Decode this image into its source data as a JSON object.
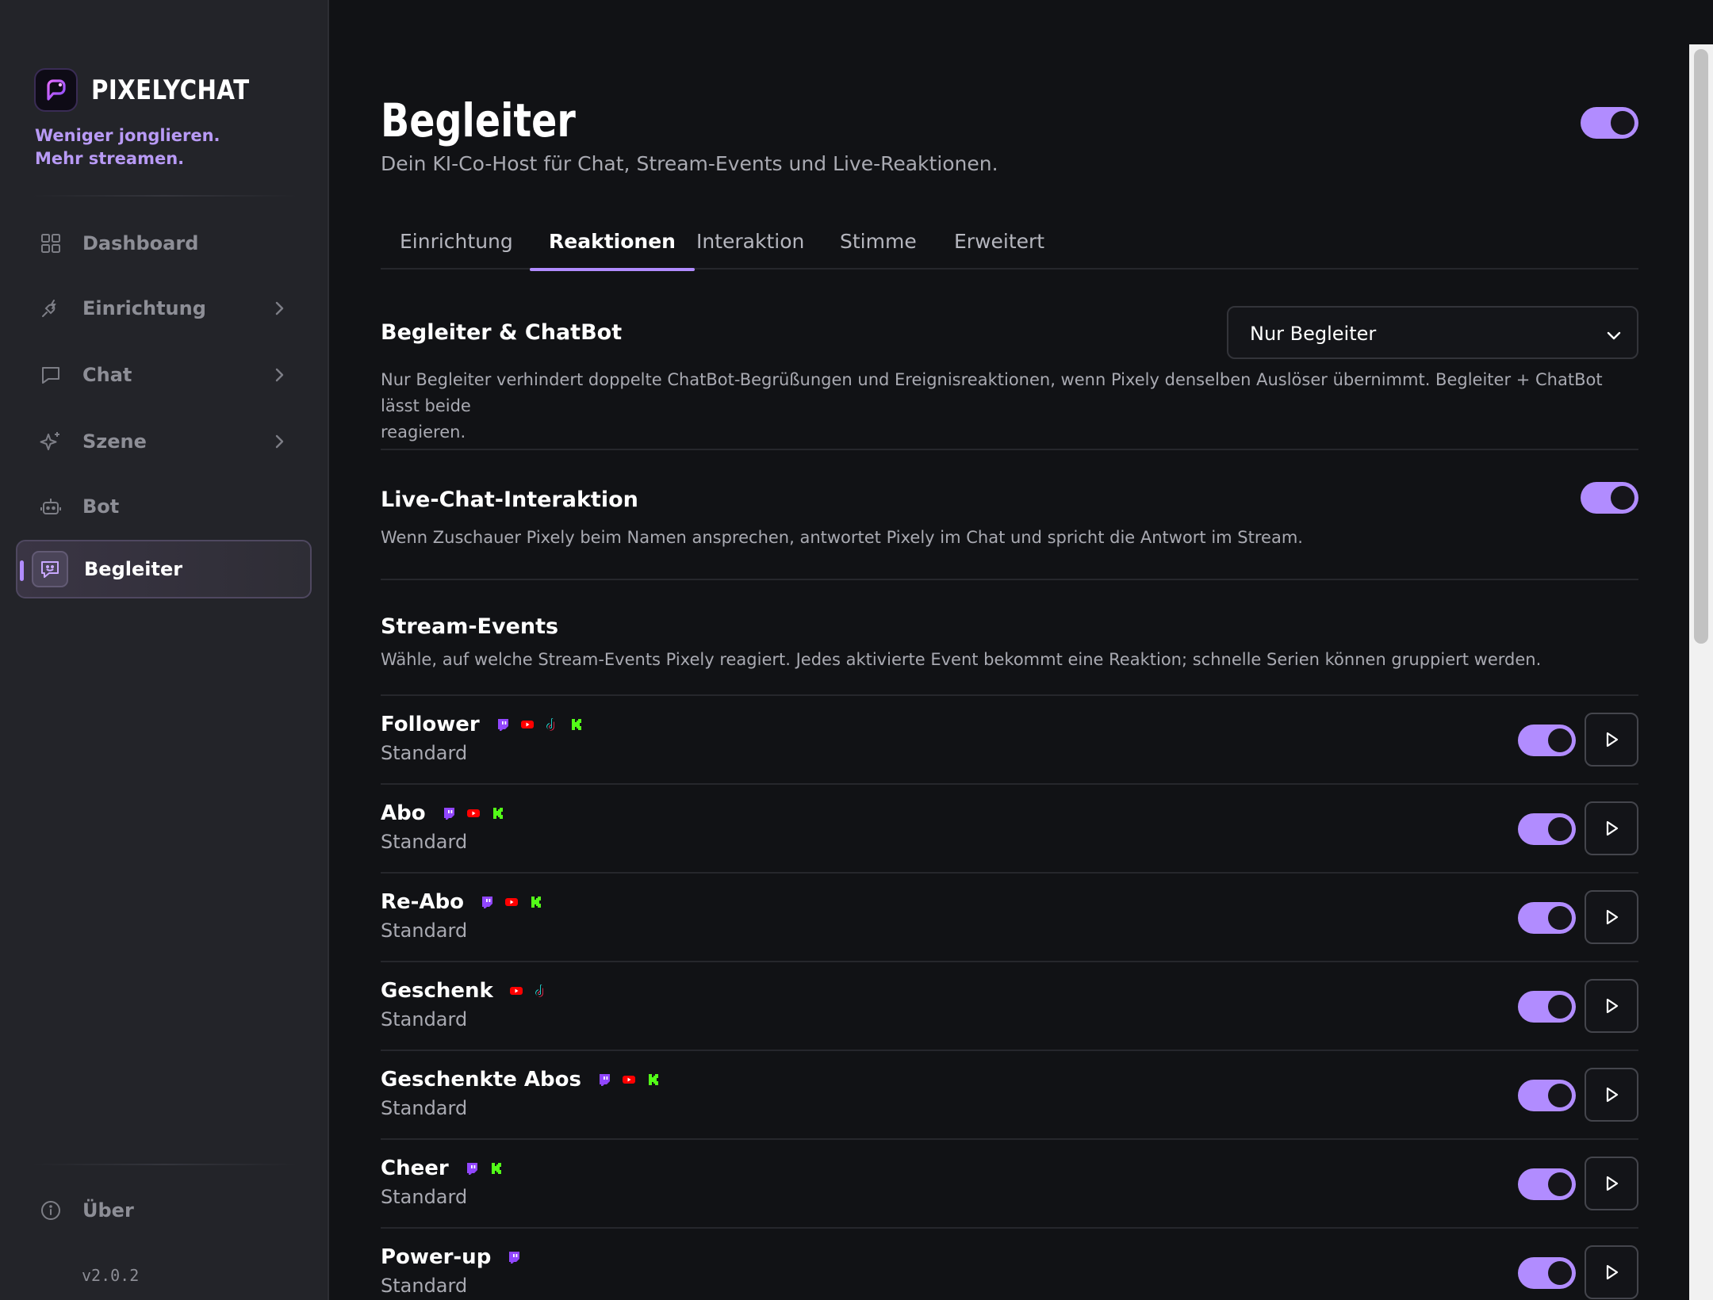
{
  "sidebar": {
    "brand": "PIXELYCHAT",
    "tagline_line1": "Weniger jonglieren.",
    "tagline_line2": "Mehr streamen.",
    "items": [
      {
        "label": "Dashboard",
        "icon": "grid-icon"
      },
      {
        "label": "Einrichtung",
        "icon": "plug-icon"
      },
      {
        "label": "Chat",
        "icon": "message-icon"
      },
      {
        "label": "Szene",
        "icon": "sparkle-icon"
      },
      {
        "label": "Bot",
        "icon": "bot-icon"
      },
      {
        "label": "Begleiter",
        "icon": "companion-icon"
      }
    ],
    "about": "Über",
    "version": "v2.0.2"
  },
  "page": {
    "title": "Begleiter",
    "subtitle": "Dein KI-Co-Host für Chat, Stream-Events und Live-Reaktionen.",
    "master_enabled": true
  },
  "tabs": [
    "Einrichtung",
    "Reaktionen",
    "Interaktion",
    "Stimme",
    "Erweitert"
  ],
  "active_tab": "Reaktionen",
  "companion_chatbot": {
    "title": "Begleiter & ChatBot",
    "selected": "Nur Begleiter",
    "desc_line1": "Nur Begleiter verhindert doppelte ChatBot-Begrüßungen und Ereignisreaktionen, wenn Pixely denselben Auslöser übernimmt. Begleiter + ChatBot lässt beide",
    "desc_line2": "reagieren."
  },
  "live_chat": {
    "title": "Live-Chat-Interaktion",
    "desc": "Wenn Zuschauer Pixely beim Namen ansprechen, antwortet Pixely im Chat und spricht die Antwort im Stream.",
    "enabled": true
  },
  "stream_events": {
    "title": "Stream-Events",
    "desc": "Wähle, auf welche Stream-Events Pixely reagiert. Jedes aktivierte Event bekommt eine Reaktion; schnelle Serien können gruppiert werden.",
    "events": [
      {
        "name": "Follower",
        "sub": "Standard",
        "platforms": [
          "twitch",
          "youtube",
          "tiktok",
          "kick"
        ],
        "enabled": true
      },
      {
        "name": "Abo",
        "sub": "Standard",
        "platforms": [
          "twitch",
          "youtube",
          "kick"
        ],
        "enabled": true
      },
      {
        "name": "Re-Abo",
        "sub": "Standard",
        "platforms": [
          "twitch",
          "youtube",
          "kick"
        ],
        "enabled": true
      },
      {
        "name": "Geschenk",
        "sub": "Standard",
        "platforms": [
          "youtube",
          "tiktok"
        ],
        "enabled": true
      },
      {
        "name": "Geschenkte Abos",
        "sub": "Standard",
        "platforms": [
          "twitch",
          "youtube",
          "kick"
        ],
        "enabled": true
      },
      {
        "name": "Cheer",
        "sub": "Standard",
        "platforms": [
          "twitch",
          "kick"
        ],
        "enabled": true
      },
      {
        "name": "Power-up",
        "sub": "Standard",
        "platforms": [
          "twitch"
        ],
        "enabled": true
      }
    ]
  },
  "colors": {
    "accent": "#b18cff",
    "twitch": "#9146ff",
    "youtube": "#ff0000",
    "kick": "#53fc18",
    "tiktok": "#111111"
  }
}
